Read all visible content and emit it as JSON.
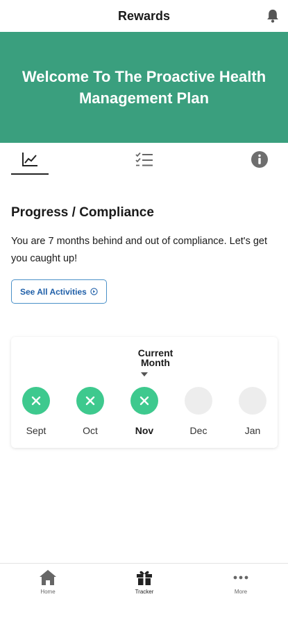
{
  "header": {
    "title": "Rewards",
    "notification_icon": "bell-icon"
  },
  "banner": {
    "title": "Welcome To The Proactive Health Management Plan",
    "background": "#3a9f7e"
  },
  "tabs": [
    {
      "icon": "line-chart-icon",
      "active": true
    },
    {
      "icon": "checklist-icon",
      "active": false
    },
    {
      "icon": "info-icon",
      "active": false
    }
  ],
  "progress": {
    "title": "Progress / Compliance",
    "description": "You are 7 months behind and out of compliance. Let's get you caught up!",
    "button_label": "See All Activities"
  },
  "tracker": {
    "current_label": "Current Month",
    "months": [
      {
        "label": "Sept",
        "status": "missed"
      },
      {
        "label": "Oct",
        "status": "missed"
      },
      {
        "label": "Nov",
        "status": "missed",
        "current": true
      },
      {
        "label": "Dec",
        "status": "upcoming"
      },
      {
        "label": "Jan",
        "status": "upcoming"
      }
    ],
    "accent": "#3ec98e"
  },
  "bottom_nav": [
    {
      "label": "Home",
      "icon": "home-icon"
    },
    {
      "label": "Tracker",
      "icon": "gift-icon",
      "active": true
    },
    {
      "label": "More",
      "icon": "more-dots-icon"
    }
  ]
}
